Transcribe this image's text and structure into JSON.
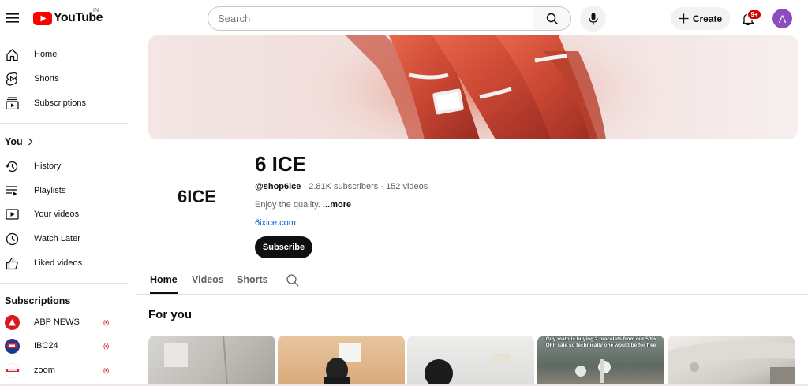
{
  "header": {
    "logo_text": "YouTube",
    "country_code": "IN",
    "search_placeholder": "Search",
    "create_label": "Create",
    "notification_count": "9+",
    "avatar_initial": "A"
  },
  "sidebar": {
    "main": [
      {
        "label": "Home",
        "icon": "home-icon"
      },
      {
        "label": "Shorts",
        "icon": "shorts-icon"
      },
      {
        "label": "Subscriptions",
        "icon": "subscriptions-icon"
      }
    ],
    "you_heading": "You",
    "you_items": [
      {
        "label": "History",
        "icon": "history-icon"
      },
      {
        "label": "Playlists",
        "icon": "playlists-icon"
      },
      {
        "label": "Your videos",
        "icon": "your-videos-icon"
      },
      {
        "label": "Watch Later",
        "icon": "watch-later-icon"
      },
      {
        "label": "Liked videos",
        "icon": "like-icon"
      }
    ],
    "subscriptions_heading": "Subscriptions",
    "subscriptions": [
      {
        "label": "ABP NEWS",
        "icon_color": "#d71920",
        "live": true
      },
      {
        "label": "IBC24",
        "icon_color": "#1a3a8a",
        "live": true
      },
      {
        "label": "zoom",
        "icon_color": "#ffffff",
        "live": true
      }
    ]
  },
  "channel": {
    "name": "6 ICE",
    "logo_text": "6ICE",
    "handle": "@shop6ice",
    "subscribers": "2.81K subscribers",
    "videos": "152 videos",
    "description": "Enjoy the quality.",
    "more_label": "...more",
    "link": "6ixice.com",
    "subscribe_label": "Subscribe"
  },
  "tabs": [
    {
      "label": "Home",
      "active": true
    },
    {
      "label": "Videos",
      "active": false
    },
    {
      "label": "Shorts",
      "active": false
    }
  ],
  "section_title": "For you",
  "thumbnails": [
    {
      "caption": ""
    },
    {
      "caption": ""
    },
    {
      "caption": ""
    },
    {
      "caption": "Guy math is buying 2 bracelets from our 50% OFF sale so technically one would be for free"
    },
    {
      "caption": ""
    }
  ],
  "colors": {
    "brand_red": "#ff0000",
    "link_blue": "#065fd4",
    "avatar_purple": "#8b4dbd",
    "live_red": "#cc0000"
  }
}
